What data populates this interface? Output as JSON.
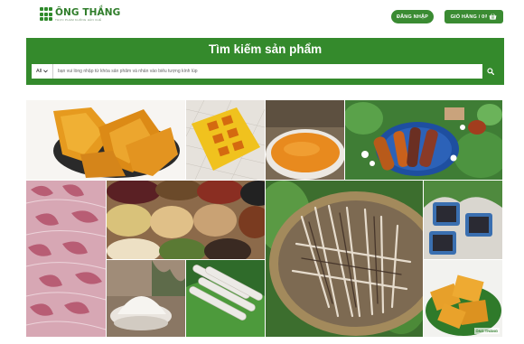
{
  "header": {
    "logo_name": "ÔNG THẮNG",
    "logo_tagline": "THỰC PHẨM KHÔNG HÀN CHẾ",
    "login_label": "ĐĂNG NHẬP",
    "cart_label": "GIỎ HÀNG / 0₫"
  },
  "search": {
    "title": "Tìm kiếm sản phẩm",
    "category_selected": "All",
    "placeholder": "bạn vui lòng nhập từ khóa sản phẩm và nhấn vào biểu tượng kính lúp"
  },
  "gallery": {
    "watermark_text": "ÔNG THẮNG",
    "tiles": [
      "dried-mango-on-plate",
      "sugar-candy-on-yellow-tray",
      "fruit-jam-in-bowl",
      "dried-sweet-potatoes-on-blue-plate",
      "dried-red-onions",
      "assorted-beans-and-grains",
      "dried-fish-strips-on-basket",
      "black-beans-in-blue-bowls",
      "white-flour-in-bowl",
      "rice-paper-rolls-on-leaf",
      "dried-mango-slices-on-leaf"
    ]
  },
  "colors": {
    "brand_green": "#348a2c",
    "button_green": "#3a8b32",
    "white": "#ffffff"
  }
}
